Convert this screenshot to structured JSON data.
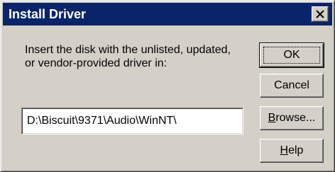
{
  "window": {
    "title": "Install Driver"
  },
  "instruction": {
    "line1": "Insert the disk with the unlisted, updated,",
    "line2": "or vendor-provided driver in:"
  },
  "path_field": {
    "value": "D:\\Biscuit\\9371\\Audio\\WinNT\\"
  },
  "buttons": {
    "ok": "OK",
    "cancel": "Cancel",
    "browse_mnemonic": "B",
    "browse_rest": "rowse...",
    "help_mnemonic": "H",
    "help_rest": "elp"
  },
  "icons": {
    "close": "close-icon"
  },
  "colors": {
    "titlebar": "#0a246a",
    "face": "#d4d0c8"
  }
}
